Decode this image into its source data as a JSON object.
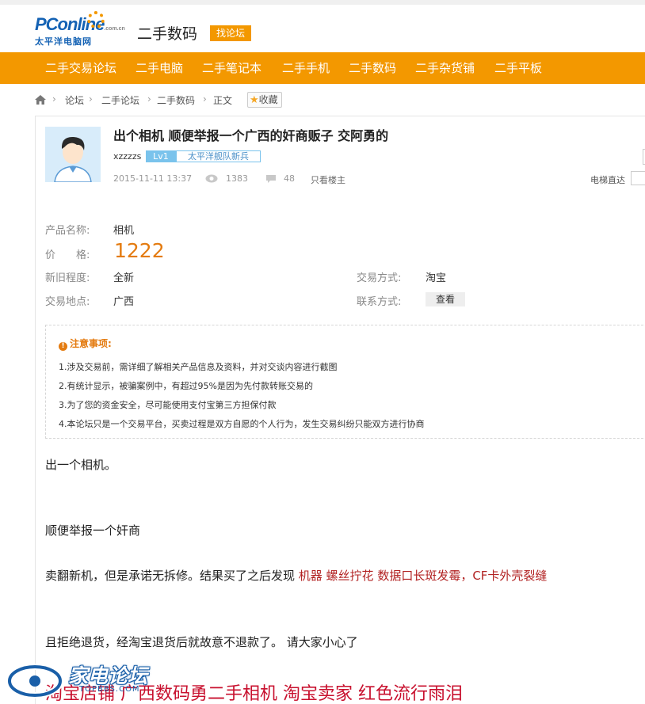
{
  "header": {
    "logo_text": "PConline",
    "logo_domain": ".com.cn",
    "logo_sub": "太平洋电脑网",
    "site_title": "二手数码",
    "forum_button": "找论坛"
  },
  "nav": {
    "items": [
      "二手交易论坛",
      "二手电脑",
      "二手笔记本",
      "二手手机",
      "二手数码",
      "二手杂货铺",
      "二手平板"
    ]
  },
  "breadcrumb": {
    "items": [
      "论坛",
      "二手论坛",
      "二手数码",
      "正文"
    ],
    "favorite_label": "收藏"
  },
  "post": {
    "title": "出个相机 顺便举报一个广西的奸商贩子 交阿勇的",
    "author": "xzzzzs",
    "level": "Lv1",
    "rank": "太平洋舰队新兵",
    "datetime": "2015-11-11 13:37",
    "views": "1383",
    "replies": "48",
    "only_op": "只看楼主",
    "elevator": "电梯直达"
  },
  "product": {
    "name_label": "产品名称:",
    "name": "相机",
    "price_label": "价　　格:",
    "price": "1222",
    "condition_label": "新旧程度:",
    "condition": "全新",
    "trade_method_label": "交易方式:",
    "trade_method": "淘宝",
    "location_label": "交易地点:",
    "location": "广西",
    "contact_label": "联系方式:",
    "contact_button": "查看"
  },
  "notice": {
    "title": "注意事项:",
    "lines": [
      "1.涉及交易前，需详细了解相关产品信息及资料，并对交谈内容进行截图",
      "2.有统计显示，被骗案例中，有超过95%是因为先付款转账交易的",
      "3.为了您的资金安全，尽可能使用支付宝第三方担保付款",
      "4.本论坛只是一个交易平台，买卖过程是双方自愿的个人行为，发生交易纠纷只能双方进行协商"
    ]
  },
  "content": {
    "p1": "出一个相机。",
    "p2": "顺便举报一个奸商",
    "p3_start": "卖翻新机，但是承诺无拆修。结果买了之后发现 ",
    "p3_red": "机器 螺丝拧花  数据口长斑发霉，CF卡外壳裂缝",
    "p4": "且拒绝退货，经淘宝退货后就故意不退款了。  请大家小心了",
    "p5": "淘宝店铺 广西数码勇二手相机  淘宝卖家  红色流行雨泪"
  },
  "watermark": {
    "text": "家电论坛",
    "url": "TOPBBS.COM"
  },
  "colors": {
    "accent": "#f39800",
    "price": "#e47b10",
    "link_red": "#b22222"
  }
}
